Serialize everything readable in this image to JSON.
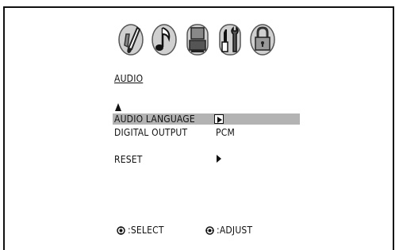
{
  "menu": {
    "icons": [
      "paint-brush-icon",
      "music-note-icon",
      "video-icon",
      "tools-icon",
      "lock-icon"
    ],
    "section_title": "AUDIO",
    "items": [
      {
        "label": "AUDIO LANGUAGE",
        "value": "",
        "selected": true
      },
      {
        "label": "DIGITAL OUTPUT",
        "value": "PCM",
        "selected": false
      },
      {
        "label": "RESET",
        "value": "",
        "selected": false
      }
    ]
  },
  "hints": {
    "select": ":SELECT",
    "adjust": ":ADJUST"
  },
  "colors": {
    "highlight": "#b3b3b3",
    "icon_light": "#d0d0d0",
    "icon_dark": "#555555",
    "frame": "#111111"
  }
}
